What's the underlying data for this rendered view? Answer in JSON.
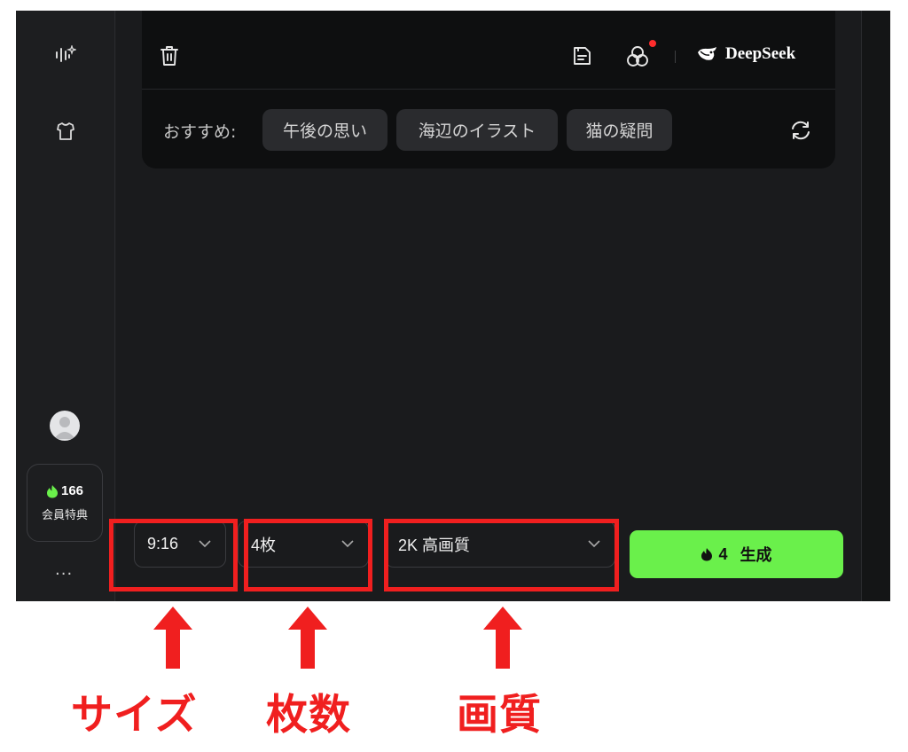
{
  "sidebar": {
    "icons": [
      "waveform-sparkle-icon",
      "shirt-icon"
    ],
    "points": {
      "value": "166",
      "label": "会員特典",
      "icon": "flame-icon"
    },
    "more_label": "..."
  },
  "top_bar": {
    "icons": [
      "trash-icon",
      "save-icon",
      "styles-icon",
      "deepseek-logo-icon"
    ],
    "brand": "DeepSeek",
    "notification_dot_color": "#ff2d2d"
  },
  "recommend": {
    "label": "おすすめ:",
    "chips": [
      "午後の思い",
      "海辺のイラスト",
      "猫の疑問"
    ],
    "refresh_icon": "refresh-icon"
  },
  "controls": {
    "aspect": "9:16",
    "count": "4枚",
    "quality": "2K 高画質",
    "generate": {
      "cost": "4",
      "label": "生成",
      "icon": "flame-icon",
      "color": "#6af04b"
    }
  },
  "annotations": {
    "labels": [
      "サイズ",
      "枚数",
      "画質"
    ],
    "color": "#f01f1f"
  }
}
